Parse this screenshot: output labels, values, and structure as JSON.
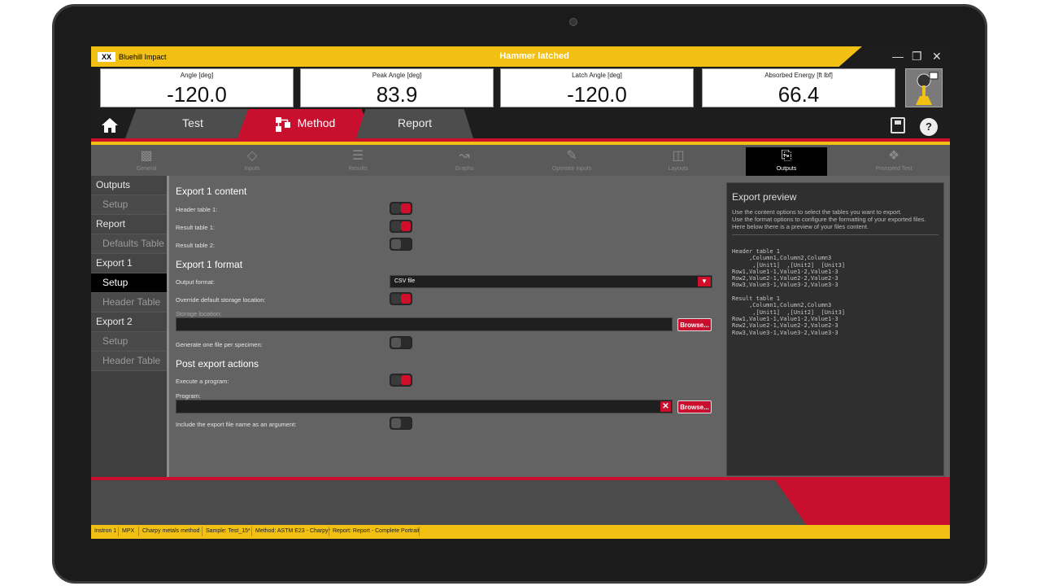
{
  "app": {
    "logo_text": "XX",
    "name": "Bluehill Impact",
    "status_title": "Hammer latched"
  },
  "readouts": [
    {
      "label": "Angle  [deg]",
      "value": "-120.0"
    },
    {
      "label": "Peak Angle  [deg]",
      "value": "83.9"
    },
    {
      "label": "Latch Angle  [deg]",
      "value": "-120.0"
    },
    {
      "label": "Absorbed Energy  [ft lbf]",
      "value": "66.4"
    }
  ],
  "main_tabs": [
    {
      "label": "Test",
      "active": false
    },
    {
      "label": "Method",
      "active": true
    },
    {
      "label": "Report",
      "active": false
    }
  ],
  "help_label": "?",
  "sub_tabs": [
    {
      "label": "General",
      "icon": "general-icon"
    },
    {
      "label": "Inputs",
      "icon": "inputs-icon"
    },
    {
      "label": "Results",
      "icon": "results-icon"
    },
    {
      "label": "Graphs",
      "icon": "graphs-icon"
    },
    {
      "label": "Operator inputs",
      "icon": "operator-inputs-icon"
    },
    {
      "label": "Layouts",
      "icon": "layouts-icon"
    },
    {
      "label": "Outputs",
      "icon": "outputs-icon",
      "active": true
    },
    {
      "label": "Prompted Test",
      "icon": "prompted-test-icon"
    }
  ],
  "sidenav": [
    {
      "label": "Outputs",
      "type": "head"
    },
    {
      "label": "Setup",
      "type": "sub"
    },
    {
      "label": "Report",
      "type": "head"
    },
    {
      "label": "Defaults Table",
      "type": "sub"
    },
    {
      "label": "Export 1",
      "type": "head"
    },
    {
      "label": "Setup",
      "type": "sub",
      "active": true
    },
    {
      "label": "Header Table",
      "type": "sub"
    },
    {
      "label": "Export 2",
      "type": "head"
    },
    {
      "label": "Setup",
      "type": "sub"
    },
    {
      "label": "Header Table",
      "type": "sub"
    }
  ],
  "form": {
    "content_title": "Export 1 content",
    "header_table_1_label": "Header table 1:",
    "header_table_1_on": true,
    "result_table_1_label": "Result table 1:",
    "result_table_1_on": true,
    "result_table_2_label": "Result table 2:",
    "result_table_2_on": false,
    "format_title": "Export 1 format",
    "output_format_label": "Output format:",
    "output_format_value": "CSV file",
    "override_label": "Override default storage location:",
    "override_on": true,
    "storage_label": "Storage location:",
    "storage_value": "",
    "browse_label": "Browse...",
    "one_file_label": "Generate one file per specimen:",
    "one_file_on": false,
    "post_title": "Post export actions",
    "execute_label": "Execute a program:",
    "execute_on": true,
    "program_label": "Program:",
    "program_value": "",
    "include_label": "Include the export file name as an argument:",
    "include_on": false
  },
  "preview": {
    "title": "Export preview",
    "line1": "Use the content options to select the tables you want to export.",
    "line2": "Use the format options to configure the formatting of your exported files.",
    "line3": "Here below there is a preview of your files content.",
    "code": "Header table 1\n     ,Column1,Column2,Column3\n      ,[Unit1]  ,[Unit2]  [Unit3]\nRow1,Value1-1,Value1-2,Value1-3\nRow2,Value2-1,Value2-2,Value2-3\nRow3,Value3-1,Value3-2,Value3-3\n\nResult table 1\n     ,Column1,Column2,Column3\n      ,[Unit1]  ,[Unit2]  [Unit3]\nRow1,Value1-1,Value1-2,Value1-3\nRow2,Value2-1,Value2-2,Value2-3\nRow3,Value3-1,Value3-2,Value3-3"
  },
  "statusbar": [
    "Instron 1",
    "MPX",
    "Charpy metals method",
    "Sample: Test_15*",
    "Method: ASTM E23 - Charpy*",
    "Report: Report - Complete Portrait"
  ],
  "colors": {
    "accent_red": "#c8102e",
    "accent_yellow": "#f2c012",
    "panel_gray": "#636363"
  }
}
